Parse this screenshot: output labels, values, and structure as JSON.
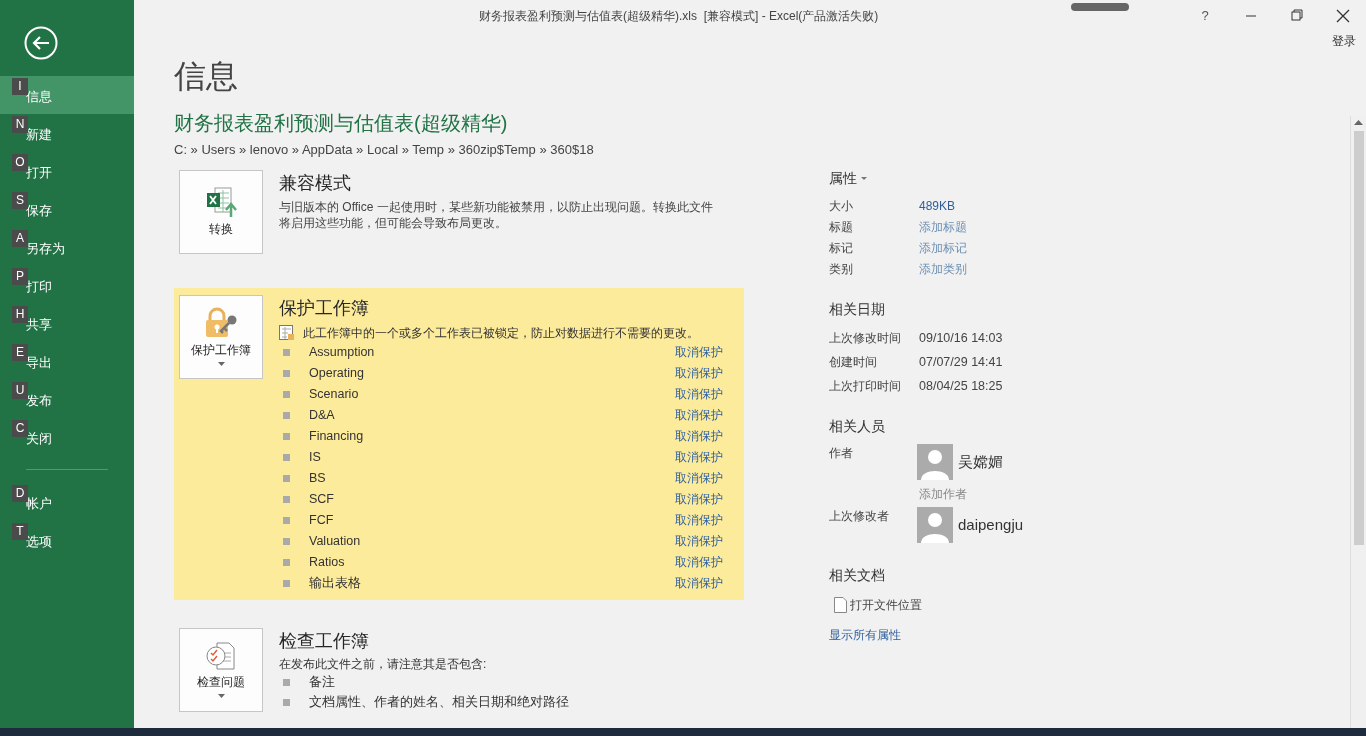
{
  "window": {
    "title": "财务报表盈利预测与估值表(超级精华).xls  [兼容模式] - Excel(产品激活失败)",
    "sign_in": "登录",
    "help": "?"
  },
  "sidebar": {
    "items": [
      {
        "key": "I",
        "label": "信息",
        "selected": true
      },
      {
        "key": "N",
        "label": "新建",
        "selected": false
      },
      {
        "key": "O",
        "label": "打开",
        "selected": false
      },
      {
        "key": "S",
        "label": "保存",
        "selected": false
      },
      {
        "key": "A",
        "label": "另存为",
        "selected": false
      },
      {
        "key": "P",
        "label": "打印",
        "selected": false
      },
      {
        "key": "H",
        "label": "共享",
        "selected": false
      },
      {
        "key": "E",
        "label": "导出",
        "selected": false
      },
      {
        "key": "U",
        "label": "发布",
        "selected": false
      },
      {
        "key": "C",
        "label": "关闭",
        "selected": false
      }
    ],
    "bottom_items": [
      {
        "key": "D",
        "label": "帐户",
        "selected": false
      },
      {
        "key": "T",
        "label": "选项",
        "selected": false
      }
    ]
  },
  "page_title": "信息",
  "file_name": "财务报表盈利预测与估值表(超级精华)",
  "path": "C: » Users » lenovo » AppData » Local » Temp » 360zip$Temp » 360$18",
  "compat": {
    "button": "转换",
    "title": "兼容模式",
    "description": "与旧版本的 Office 一起使用时，某些新功能被禁用，以防止出现问题。转换此文件将启用这些功能，但可能会导致布局更改。"
  },
  "protect": {
    "button": "保护工作簿",
    "title": "保护工作簿",
    "description": "此工作簿中的一个或多个工作表已被锁定，防止对数据进行不需要的更改。",
    "sheets": [
      {
        "name": "Assumption",
        "action": "取消保护"
      },
      {
        "name": "Operating",
        "action": "取消保护"
      },
      {
        "name": "Scenario",
        "action": "取消保护"
      },
      {
        "name": "D&A",
        "action": "取消保护"
      },
      {
        "name": "Financing",
        "action": "取消保护"
      },
      {
        "name": "IS",
        "action": "取消保护"
      },
      {
        "name": "BS",
        "action": "取消保护"
      },
      {
        "name": "SCF",
        "action": "取消保护"
      },
      {
        "name": "FCF",
        "action": "取消保护"
      },
      {
        "name": "Valuation",
        "action": "取消保护"
      },
      {
        "name": "Ratios",
        "action": "取消保护"
      },
      {
        "name": "输出表格",
        "action": "取消保护"
      }
    ]
  },
  "inspect": {
    "button": "检查问题",
    "title": "检查工作簿",
    "description": "在发布此文件之前，请注意其是否包含:",
    "items": [
      "备注",
      "文档属性、作者的姓名、相关日期和绝对路径"
    ]
  },
  "properties": {
    "title": "属性",
    "rows": [
      {
        "label": "大小",
        "value": "489KB",
        "kind": "text"
      },
      {
        "label": "标题",
        "value": "添加标题",
        "kind": "hint"
      },
      {
        "label": "标记",
        "value": "添加标记",
        "kind": "hint"
      },
      {
        "label": "类别",
        "value": "添加类别",
        "kind": "hint"
      }
    ]
  },
  "dates": {
    "title": "相关日期",
    "rows": [
      {
        "label": "上次修改时间",
        "value": "09/10/16 14:03"
      },
      {
        "label": "创建时间",
        "value": "07/07/29 14:41"
      },
      {
        "label": "上次打印时间",
        "value": "08/04/25 18:25"
      }
    ]
  },
  "people": {
    "title": "相关人员",
    "author_label": "作者",
    "author": "吴嫦媚",
    "add_author": "添加作者",
    "modifier_label": "上次修改者",
    "modifier": "daipengju"
  },
  "documents": {
    "title": "相关文档",
    "open_location": "打开文件位置",
    "show_all": "显示所有属性"
  }
}
